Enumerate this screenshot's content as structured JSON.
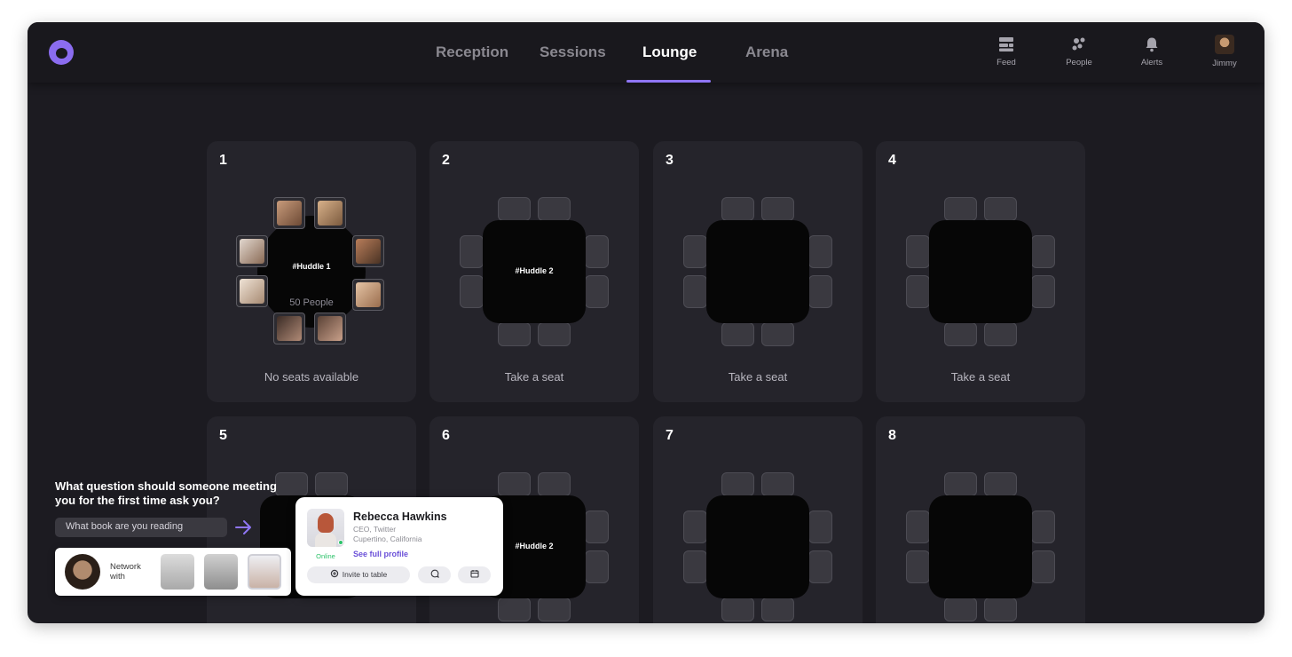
{
  "nav": {
    "tabs": [
      {
        "label": "Reception",
        "active": false
      },
      {
        "label": "Sessions",
        "active": false
      },
      {
        "label": "Lounge",
        "active": true
      },
      {
        "label": "Arena",
        "active": false
      }
    ],
    "actions": [
      {
        "label": "Feed",
        "icon": "feed-icon"
      },
      {
        "label": "People",
        "icon": "people-icon"
      },
      {
        "label": "Alerts",
        "icon": "bell-icon"
      },
      {
        "label": "Jimmy",
        "icon": "user-avatar"
      }
    ]
  },
  "colors": {
    "accent": "#8f76f5",
    "background": "#1c1b21",
    "card": "#25242b",
    "online": "#2dc26a"
  },
  "tables": [
    {
      "number": "1",
      "label": "#Huddle 1",
      "count": "50 People",
      "caption": "No seats available"
    },
    {
      "number": "2",
      "label": "#Huddle 2",
      "caption": "Take a seat"
    },
    {
      "number": "3",
      "label": "",
      "caption": "Take a seat"
    },
    {
      "number": "4",
      "label": "",
      "caption": "Take a seat"
    },
    {
      "number": "5",
      "label": "",
      "caption": ""
    },
    {
      "number": "6",
      "label": "#Huddle 2",
      "caption": ""
    },
    {
      "number": "7",
      "label": "",
      "caption": ""
    },
    {
      "number": "8",
      "label": "",
      "caption": ""
    }
  ],
  "prompt": {
    "question": "What question should someone meeting you for the first time ask you?",
    "answer": "What book are you reading"
  },
  "network": {
    "label": "Network with"
  },
  "profile": {
    "name": "Rebecca Hawkins",
    "title": "CEO, Twitter",
    "location": "Cupertino, California",
    "status": "Online",
    "link": "See full profile",
    "invite": "Invite to table"
  }
}
